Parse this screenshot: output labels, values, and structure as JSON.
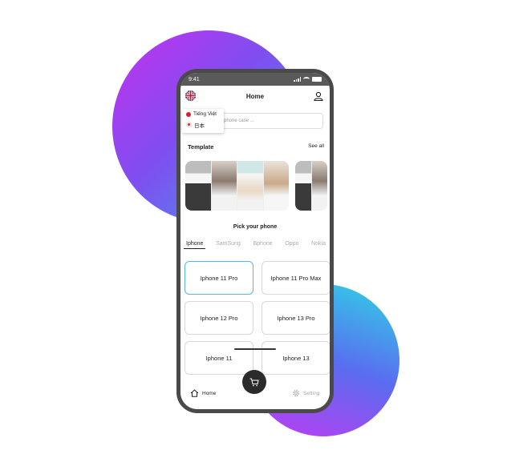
{
  "status": {
    "time": "9:41"
  },
  "header": {
    "title": "Home",
    "flag_icon": "uk-flag-icon",
    "user_icon": "user-icon"
  },
  "language_menu": {
    "items": [
      {
        "label": "Tiếng Việt"
      },
      {
        "label": "日本"
      }
    ]
  },
  "search": {
    "placeholder": "h phone case ..."
  },
  "template_section": {
    "title": "Template",
    "see_all": "See all"
  },
  "pick_title": "Pick your phone",
  "tabs": [
    {
      "label": "Iphone",
      "active": true
    },
    {
      "label": "SamSung",
      "active": false
    },
    {
      "label": "Bphone",
      "active": false
    },
    {
      "label": "Oppo",
      "active": false
    },
    {
      "label": "Nokia",
      "active": false
    }
  ],
  "phones": [
    {
      "label": "Iphone 11 Pro",
      "selected": true
    },
    {
      "label": "Iphone 11 Pro Max",
      "selected": false
    },
    {
      "label": "Iphone 12 Pro",
      "selected": false
    },
    {
      "label": "Iphone 13 Pro",
      "selected": false
    },
    {
      "label": "Iphone 11",
      "selected": false
    },
    {
      "label": "Iphone 13",
      "selected": false
    }
  ],
  "bottom_nav": {
    "home": "Home",
    "setting": "Setting",
    "cart_icon": "cart-icon"
  },
  "colors": {
    "selected_border": "#5ab4e8",
    "accent_dark": "#2b2b2b",
    "flag_red": "#d91e2a"
  }
}
